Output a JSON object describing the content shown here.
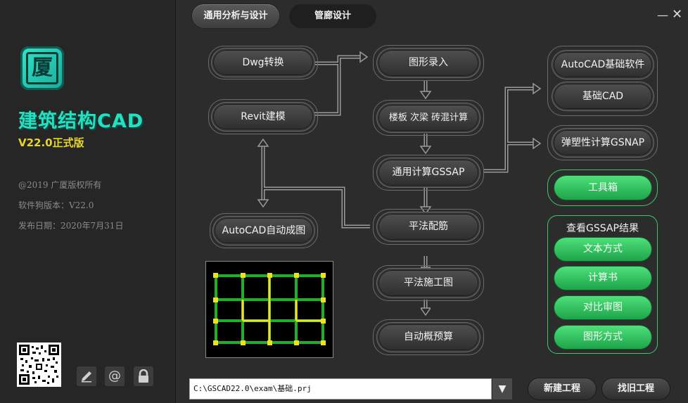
{
  "sidebar": {
    "logo_char": "厦",
    "product_name": "建筑结构CAD",
    "version": "V22.0正式版",
    "copyright": "@2019 广厦版权所有",
    "dongle_version": "软件狗版本：V22.0",
    "release_date": "发布日期：2020年7月31日",
    "icons": [
      "pen-icon",
      "at-icon",
      "lock-icon"
    ]
  },
  "tabs": [
    "通用分析与设计",
    "管廊设计"
  ],
  "window": {
    "minimize": "—",
    "close": "✕"
  },
  "flow": {
    "dwg": "Dwg转换",
    "revit": "Revit建模",
    "autocad_auto": "AutoCAD自动成图",
    "graphic_input": "图形录入",
    "slab_beam": "楼板 次梁 砖混计算",
    "gssap": "通用计算GSSAP",
    "rebar": "平法配筋",
    "construction": "平法施工图",
    "estimate": "自动概预算",
    "autocad_foundation": "AutoCAD基础软件",
    "foundation_cad": "基础CAD",
    "gsnap": "弹塑性计算GSNAP",
    "toolbox": "工具箱"
  },
  "results": {
    "title": "查看GSSAP结果",
    "items": [
      "文本方式",
      "计算书",
      "对比审图",
      "图形方式"
    ]
  },
  "bottom": {
    "path": "C:\\GSCAD22.0\\exam\\基础.prj",
    "new_project": "新建工程",
    "open_project": "找旧工程"
  },
  "colors": {
    "accent": "#23e0c0",
    "version": "#e6d62a",
    "green": "#2ecc5e"
  }
}
